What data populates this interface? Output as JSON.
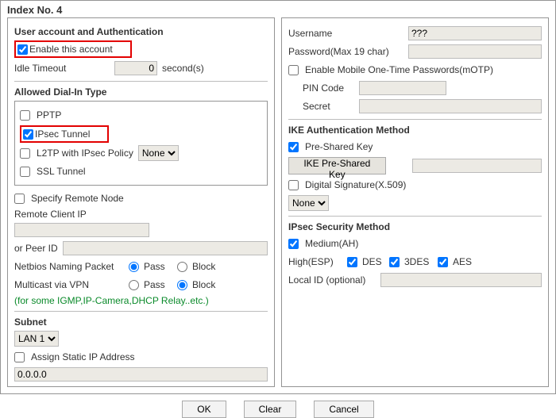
{
  "title": "Index No. 4",
  "left": {
    "userAuthHeader": "User account and Authentication",
    "enableAccount": "Enable this account",
    "idleTimeoutLabel": "Idle Timeout",
    "idleTimeoutValue": "0",
    "idleTimeoutUnit": "second(s)",
    "allowedDialInHeader": "Allowed Dial-In Type",
    "pptp": "PPTP",
    "ipsecTunnel": "IPsec Tunnel",
    "l2tpLabel": "L2TP with IPsec Policy",
    "l2tpPolicy": "None",
    "sslTunnel": "SSL Tunnel",
    "specifyRemoteNode": "Specify Remote Node",
    "remoteClientIpLabel": "Remote Client IP",
    "remoteClientIpValue": "",
    "orPeerIdLabel": "or Peer ID",
    "orPeerIdValue": "",
    "netbiosLabel": "Netbios Naming Packet",
    "multicastLabel": "Multicast via VPN",
    "passLabel": "Pass",
    "blockLabel": "Block",
    "multicastNote": "(for some IGMP,IP-Camera,DHCP Relay..etc.)",
    "subnetHeader": "Subnet",
    "subnetSelect": "LAN 1",
    "assignStaticIp": "Assign Static IP Address",
    "staticIpValue": "0.0.0.0"
  },
  "right": {
    "usernameLabel": "Username",
    "usernameValue": "???",
    "passwordLabel": "Password(Max 19 char)",
    "passwordValue": "",
    "enableMotp": "Enable Mobile One-Time Passwords(mOTP)",
    "pinCodeLabel": "PIN Code",
    "pinCodeValue": "",
    "secretLabel": "Secret",
    "secretValue": "",
    "ikeHeader": "IKE Authentication Method",
    "preSharedKeyChk": "Pre-Shared Key",
    "ikeBtn": "IKE Pre-Shared Key",
    "ikeValue": "",
    "digitalSig": "Digital Signature(X.509)",
    "digitalSelect": "None",
    "ipsecSecHeader": "IPsec Security Method",
    "mediumAh": "Medium(AH)",
    "highEsp": "High(ESP)",
    "des": "DES",
    "tripledes": "3DES",
    "aes": "AES",
    "localIdLabel": "Local ID (optional)",
    "localIdValue": ""
  },
  "buttons": {
    "ok": "OK",
    "clear": "Clear",
    "cancel": "Cancel"
  }
}
